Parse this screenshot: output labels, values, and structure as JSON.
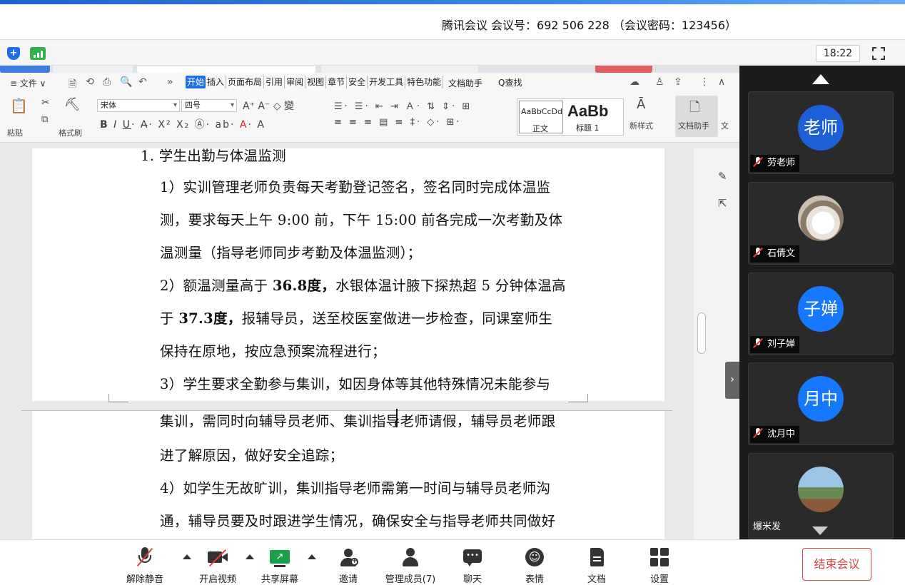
{
  "meeting_banner": {
    "info": "腾讯会议 会议号：692 506 228 （会议密码：123456）"
  },
  "meeting_header": {
    "clock": "18:22"
  },
  "wps": {
    "menu": {
      "file": "≡ 文件 ∨",
      "tabs": [
        "开始",
        "插入",
        "页面布局",
        "引用",
        "审阅",
        "视图",
        "章节",
        "安全",
        "开发工具",
        "特色功能"
      ],
      "doc_assistant": "文档助手",
      "find": "Q查找"
    },
    "ribbon": {
      "paste": "粘贴",
      "format_painter": "格式刷",
      "font_name": "宋体",
      "font_size": "四号",
      "style_normal_preview": "AaBbCcDd",
      "style_normal_name": "正文",
      "style_heading_preview": "AaBb",
      "style_heading_name": "标题 1",
      "new_style": "新样式",
      "doc_assistant": "文档助手",
      "text_cut": "文"
    },
    "document": {
      "lines": [
        {
          "text": "1.   学生出勤与体温监测"
        },
        {
          "text": "1）实训管理老师负责每天考勤登记签名，签名同时完成体温监"
        },
        {
          "text": "测，要求每天上午 9:00 前，下午 15:00 前各完成一次考勤及体"
        },
        {
          "text": "温测量（指导老师同步考勤及体温监测）；"
        },
        {
          "pre": "2）额温测量高于 ",
          "bold": "36.8度，",
          "post": "水银体温计腋下探热超 5 分钟体温高"
        },
        {
          "pre": "于 ",
          "bold": "37.3度，",
          "post": "报辅导员，送至校医室做进一步检查，同课室师生"
        },
        {
          "text": "保持在原地，按应急预案流程进行；"
        },
        {
          "text": "3）学生要求全勤参与集训，如因身体等其他特殊情况未能参与"
        },
        {
          "text": "集训，需同时向辅导员老师、集训指导老师请假，辅导员老师跟"
        },
        {
          "text": "进了解原因，做好安全追踪；"
        },
        {
          "text": "4）如学生无故旷训，集训指导老师需第一时间与辅导员老师沟"
        },
        {
          "text": "通，辅导员要及时跟进学生情况，确保安全与指导老师共同做好"
        }
      ]
    }
  },
  "participants": [
    {
      "name": "劳老师",
      "avatar_text": "老师",
      "avatar_color": "#1d5fd6",
      "muted": true
    },
    {
      "name": "石倩文",
      "avatar_text": "",
      "avatar_color": "#d9d2c8",
      "muted": true,
      "photo": "cat"
    },
    {
      "name": "刘子婵",
      "avatar_text": "子婵",
      "avatar_color": "#1677ff",
      "muted": true
    },
    {
      "name": "沈月中",
      "avatar_text": "月中",
      "avatar_color": "#1677ff",
      "muted": true
    },
    {
      "name": "爆米发",
      "avatar_text": "",
      "avatar_color": "#8ab0d0",
      "muted": false,
      "photo": "landscape"
    }
  ],
  "toolbar": {
    "unmute": "解除静音",
    "start_video": "开启视频",
    "share_screen": "共享屏幕",
    "invite": "邀请",
    "manage_members": "管理成员(7)",
    "chat": "聊天",
    "emoji": "表情",
    "docs": "文档",
    "settings": "设置",
    "end_meeting": "结束会议"
  },
  "colors": {
    "accent": "#1e6ee8",
    "danger": "#e04040",
    "panel_bg": "#1c1c1c"
  }
}
